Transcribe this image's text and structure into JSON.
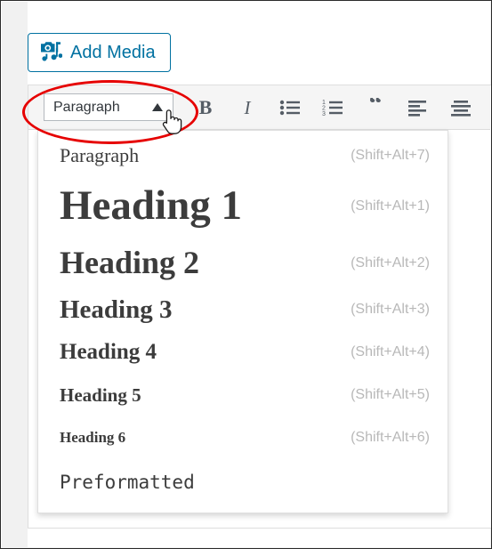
{
  "window": {
    "background_color": "#f1f1f1",
    "canvas_color": "#ffffff",
    "border_color": "#2b2b2b"
  },
  "add_media": {
    "label": "Add Media",
    "icon": "camera-music-icon",
    "accent_color": "#0071a1"
  },
  "toolbar": {
    "format_select": {
      "value": "Paragraph",
      "state": "open",
      "caret_icon": "caret-up-icon"
    },
    "buttons": [
      {
        "name": "bold-button",
        "icon": "bold-icon",
        "glyph": "B"
      },
      {
        "name": "italic-button",
        "icon": "italic-icon",
        "glyph": "I"
      },
      {
        "name": "bulleted-list-button",
        "icon": "bulleted-list-icon"
      },
      {
        "name": "numbered-list-button",
        "icon": "numbered-list-icon"
      },
      {
        "name": "blockquote-button",
        "icon": "blockquote-icon"
      },
      {
        "name": "align-left-button",
        "icon": "align-left-icon"
      },
      {
        "name": "align-center-button",
        "icon": "align-center-icon"
      }
    ],
    "icon_color": "#555d66",
    "background_color": "#f5f5f5"
  },
  "format_menu": {
    "open": true,
    "items": [
      {
        "label": "Paragraph",
        "shortcut": "(Shift+Alt+7)",
        "style": "paragraph"
      },
      {
        "label": "Heading 1",
        "shortcut": "(Shift+Alt+1)",
        "style": "h1"
      },
      {
        "label": "Heading 2",
        "shortcut": "(Shift+Alt+2)",
        "style": "h2"
      },
      {
        "label": "Heading 3",
        "shortcut": "(Shift+Alt+3)",
        "style": "h3"
      },
      {
        "label": "Heading 4",
        "shortcut": "(Shift+Alt+4)",
        "style": "h4"
      },
      {
        "label": "Heading 5",
        "shortcut": "(Shift+Alt+5)",
        "style": "h5"
      },
      {
        "label": "Heading 6",
        "shortcut": "(Shift+Alt+6)",
        "style": "h6"
      },
      {
        "label": "Preformatted",
        "shortcut": "",
        "style": "preformatted"
      }
    ],
    "label_color": "#3c3c3c",
    "shortcut_color": "#b8b8b8"
  },
  "annotation": {
    "shape": "ellipse",
    "color": "#e60000",
    "target": "format-select"
  },
  "cursor": {
    "type": "pointing-hand"
  }
}
